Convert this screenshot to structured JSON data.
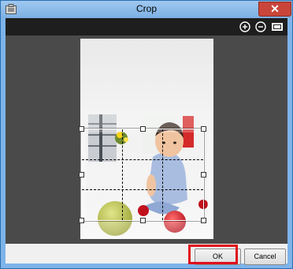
{
  "window": {
    "title": "Crop",
    "close_label": "✕"
  },
  "toolbar": {
    "icons": [
      "zoom-in-icon",
      "zoom-out-icon",
      "fit-to-screen-icon"
    ]
  },
  "canvas": {
    "image": "photo of a baby sitting on the floor with green and red apples"
  },
  "footer": {
    "ok_label": "OK",
    "cancel_label": "Cancel"
  },
  "colors": {
    "title_bar": "#7eb4ea",
    "close_button": "#c9453a",
    "canvas_background": "#4a4a4a",
    "toolbar_background": "#1e1e1e",
    "highlight": "#e0101a"
  }
}
